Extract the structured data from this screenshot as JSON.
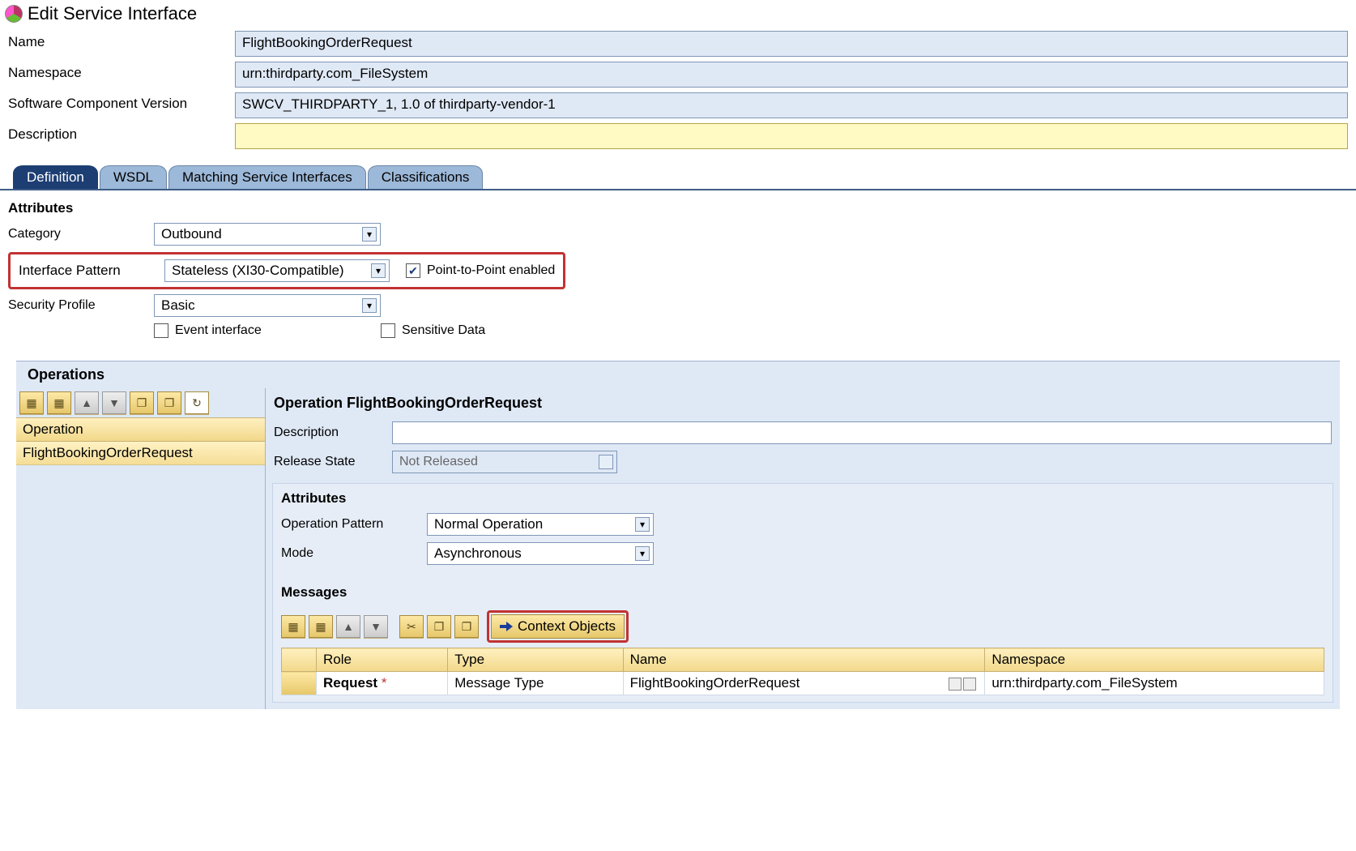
{
  "title": "Edit Service Interface",
  "header": {
    "name_label": "Name",
    "name_value": "FlightBookingOrderRequest",
    "namespace_label": "Namespace",
    "namespace_value": "urn:thirdparty.com_FileSystem",
    "swcv_label": "Software Component Version",
    "swcv_value": "SWCV_THIRDPARTY_1, 1.0 of thirdparty-vendor-1",
    "description_label": "Description",
    "description_value": ""
  },
  "tabs": [
    "Definition",
    "WSDL",
    "Matching Service Interfaces",
    "Classifications"
  ],
  "attributes": {
    "heading": "Attributes",
    "category_label": "Category",
    "category_value": "Outbound",
    "interface_pattern_label": "Interface Pattern",
    "interface_pattern_value": "Stateless (XI30-Compatible)",
    "p2p_label": "Point-to-Point enabled",
    "p2p_checked": true,
    "security_label": "Security Profile",
    "security_value": "Basic",
    "event_label": "Event interface",
    "event_checked": false,
    "sensitive_label": "Sensitive Data",
    "sensitive_checked": false
  },
  "operations": {
    "heading": "Operations",
    "list_header": "Operation",
    "list_item": "FlightBookingOrderRequest",
    "detail_heading": "Operation FlightBookingOrderRequest",
    "description_label": "Description",
    "description_value": "",
    "release_label": "Release State",
    "release_value": "Not Released",
    "sub_attrs_heading": "Attributes",
    "op_pattern_label": "Operation Pattern",
    "op_pattern_value": "Normal Operation",
    "mode_label": "Mode",
    "mode_value": "Asynchronous",
    "messages_heading": "Messages",
    "context_btn": "Context Objects",
    "msg_cols": {
      "role": "Role",
      "type": "Type",
      "name": "Name",
      "namespace": "Namespace"
    },
    "msg_row": {
      "role": "Request",
      "role_required": "*",
      "type": "Message Type",
      "name": "FlightBookingOrderRequest",
      "namespace": "urn:thirdparty.com_FileSystem"
    }
  }
}
